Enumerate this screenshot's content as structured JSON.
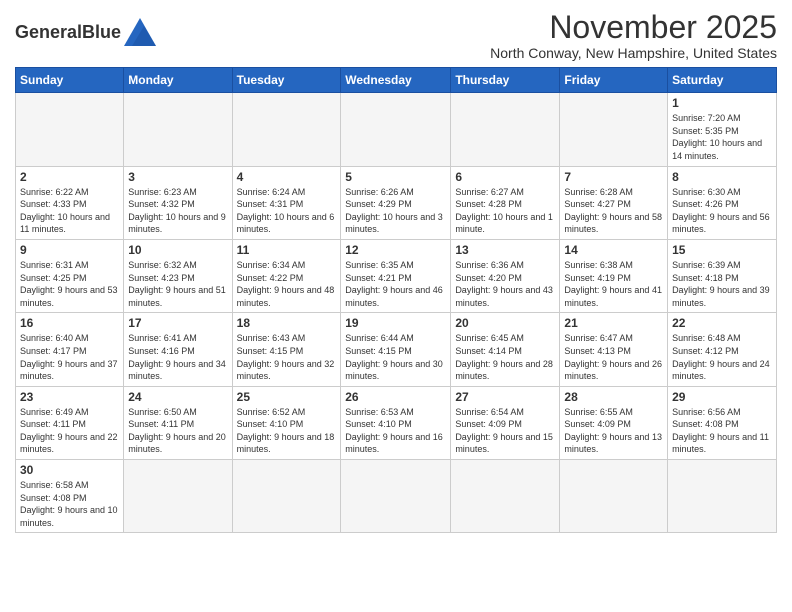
{
  "header": {
    "logo_text_regular": "General",
    "logo_text_bold": "Blue",
    "month_title": "November 2025",
    "location": "North Conway, New Hampshire, United States"
  },
  "weekdays": [
    "Sunday",
    "Monday",
    "Tuesday",
    "Wednesday",
    "Thursday",
    "Friday",
    "Saturday"
  ],
  "weeks": [
    [
      {
        "day": "",
        "info": ""
      },
      {
        "day": "",
        "info": ""
      },
      {
        "day": "",
        "info": ""
      },
      {
        "day": "",
        "info": ""
      },
      {
        "day": "",
        "info": ""
      },
      {
        "day": "",
        "info": ""
      },
      {
        "day": "1",
        "info": "Sunrise: 7:20 AM\nSunset: 5:35 PM\nDaylight: 10 hours and 14 minutes."
      }
    ],
    [
      {
        "day": "2",
        "info": "Sunrise: 6:22 AM\nSunset: 4:33 PM\nDaylight: 10 hours and 11 minutes."
      },
      {
        "day": "3",
        "info": "Sunrise: 6:23 AM\nSunset: 4:32 PM\nDaylight: 10 hours and 9 minutes."
      },
      {
        "day": "4",
        "info": "Sunrise: 6:24 AM\nSunset: 4:31 PM\nDaylight: 10 hours and 6 minutes."
      },
      {
        "day": "5",
        "info": "Sunrise: 6:26 AM\nSunset: 4:29 PM\nDaylight: 10 hours and 3 minutes."
      },
      {
        "day": "6",
        "info": "Sunrise: 6:27 AM\nSunset: 4:28 PM\nDaylight: 10 hours and 1 minute."
      },
      {
        "day": "7",
        "info": "Sunrise: 6:28 AM\nSunset: 4:27 PM\nDaylight: 9 hours and 58 minutes."
      },
      {
        "day": "8",
        "info": "Sunrise: 6:30 AM\nSunset: 4:26 PM\nDaylight: 9 hours and 56 minutes."
      }
    ],
    [
      {
        "day": "9",
        "info": "Sunrise: 6:31 AM\nSunset: 4:25 PM\nDaylight: 9 hours and 53 minutes."
      },
      {
        "day": "10",
        "info": "Sunrise: 6:32 AM\nSunset: 4:23 PM\nDaylight: 9 hours and 51 minutes."
      },
      {
        "day": "11",
        "info": "Sunrise: 6:34 AM\nSunset: 4:22 PM\nDaylight: 9 hours and 48 minutes."
      },
      {
        "day": "12",
        "info": "Sunrise: 6:35 AM\nSunset: 4:21 PM\nDaylight: 9 hours and 46 minutes."
      },
      {
        "day": "13",
        "info": "Sunrise: 6:36 AM\nSunset: 4:20 PM\nDaylight: 9 hours and 43 minutes."
      },
      {
        "day": "14",
        "info": "Sunrise: 6:38 AM\nSunset: 4:19 PM\nDaylight: 9 hours and 41 minutes."
      },
      {
        "day": "15",
        "info": "Sunrise: 6:39 AM\nSunset: 4:18 PM\nDaylight: 9 hours and 39 minutes."
      }
    ],
    [
      {
        "day": "16",
        "info": "Sunrise: 6:40 AM\nSunset: 4:17 PM\nDaylight: 9 hours and 37 minutes."
      },
      {
        "day": "17",
        "info": "Sunrise: 6:41 AM\nSunset: 4:16 PM\nDaylight: 9 hours and 34 minutes."
      },
      {
        "day": "18",
        "info": "Sunrise: 6:43 AM\nSunset: 4:15 PM\nDaylight: 9 hours and 32 minutes."
      },
      {
        "day": "19",
        "info": "Sunrise: 6:44 AM\nSunset: 4:15 PM\nDaylight: 9 hours and 30 minutes."
      },
      {
        "day": "20",
        "info": "Sunrise: 6:45 AM\nSunset: 4:14 PM\nDaylight: 9 hours and 28 minutes."
      },
      {
        "day": "21",
        "info": "Sunrise: 6:47 AM\nSunset: 4:13 PM\nDaylight: 9 hours and 26 minutes."
      },
      {
        "day": "22",
        "info": "Sunrise: 6:48 AM\nSunset: 4:12 PM\nDaylight: 9 hours and 24 minutes."
      }
    ],
    [
      {
        "day": "23",
        "info": "Sunrise: 6:49 AM\nSunset: 4:11 PM\nDaylight: 9 hours and 22 minutes."
      },
      {
        "day": "24",
        "info": "Sunrise: 6:50 AM\nSunset: 4:11 PM\nDaylight: 9 hours and 20 minutes."
      },
      {
        "day": "25",
        "info": "Sunrise: 6:52 AM\nSunset: 4:10 PM\nDaylight: 9 hours and 18 minutes."
      },
      {
        "day": "26",
        "info": "Sunrise: 6:53 AM\nSunset: 4:10 PM\nDaylight: 9 hours and 16 minutes."
      },
      {
        "day": "27",
        "info": "Sunrise: 6:54 AM\nSunset: 4:09 PM\nDaylight: 9 hours and 15 minutes."
      },
      {
        "day": "28",
        "info": "Sunrise: 6:55 AM\nSunset: 4:09 PM\nDaylight: 9 hours and 13 minutes."
      },
      {
        "day": "29",
        "info": "Sunrise: 6:56 AM\nSunset: 4:08 PM\nDaylight: 9 hours and 11 minutes."
      }
    ],
    [
      {
        "day": "30",
        "info": "Sunrise: 6:58 AM\nSunset: 4:08 PM\nDaylight: 9 hours and 10 minutes."
      },
      {
        "day": "",
        "info": ""
      },
      {
        "day": "",
        "info": ""
      },
      {
        "day": "",
        "info": ""
      },
      {
        "day": "",
        "info": ""
      },
      {
        "day": "",
        "info": ""
      },
      {
        "day": "",
        "info": ""
      }
    ]
  ]
}
